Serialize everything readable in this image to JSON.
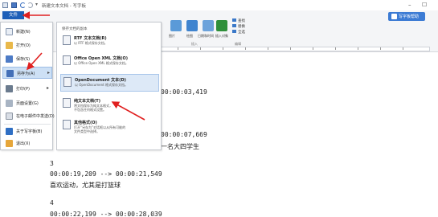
{
  "window": {
    "title": "新建文本文档 - 写字板",
    "minimize_glyph": "–",
    "maximize_glyph": "☐"
  },
  "ribbon": {
    "file_tab_label": "文件",
    "help_button_label": "写字板帮助",
    "buttons": [
      "图片",
      "绘图",
      "日期和时间",
      "插入对象"
    ],
    "small_buttons": [
      "查找",
      "替换",
      "全选"
    ],
    "groups": [
      "插入",
      "编辑"
    ]
  },
  "file_menu": {
    "items": [
      {
        "label": "新建(N)",
        "icon": "new-document-icon"
      },
      {
        "label": "打开(O)",
        "icon": "open-folder-icon"
      },
      {
        "label": "保存(S)",
        "icon": "save-disk-icon"
      },
      {
        "label": "另存为(A)",
        "icon": "save-as-icon"
      },
      {
        "label": "打印(P)",
        "icon": "printer-icon"
      },
      {
        "label": "页面设置(G)",
        "icon": "page-setup-icon"
      },
      {
        "label": "在电子邮件中发送(D)",
        "icon": "email-icon"
      },
      {
        "label": "关于写字板(B)",
        "icon": "info-icon"
      },
      {
        "label": "退出(X)",
        "icon": "exit-icon"
      }
    ],
    "submenu": {
      "header": "保存文档的副本",
      "items": [
        {
          "title": "RTF 文本文档(R)",
          "desc": "以 RTF 格式保存文档。",
          "desc2": ""
        },
        {
          "title": "Office Open XML 文档(O)",
          "desc": "以 Office Open XML 格式保存文档。",
          "desc2": ""
        },
        {
          "title": "OpenDocument 文本(D)",
          "desc": "以 OpenDocument 格式保存文档。",
          "desc2": ""
        },
        {
          "title": "纯文本文档(T)",
          "desc": "将文档保存为纯文本格式，",
          "desc2": "不包含任何格式设置。"
        },
        {
          "title": "其他格式(O)",
          "desc": "打开“另存为”对话框以从所有可能的",
          "desc2": "文件类型中选择。"
        }
      ]
    }
  },
  "document": {
    "lines": [
      "00:00:0​3,419",
      "00:00:0​7,669",
      "一名大四学生",
      "3",
      "00:00:19,209 --> 00:00:21,549",
      "喜欢运动，尤其是打篮球",
      "4",
      "00:00:22,199 --> 00:00:28,039"
    ]
  },
  "colors": {
    "accent": "#1e5fb8",
    "annotation": "#e02020",
    "selected": "#cde0f5"
  }
}
